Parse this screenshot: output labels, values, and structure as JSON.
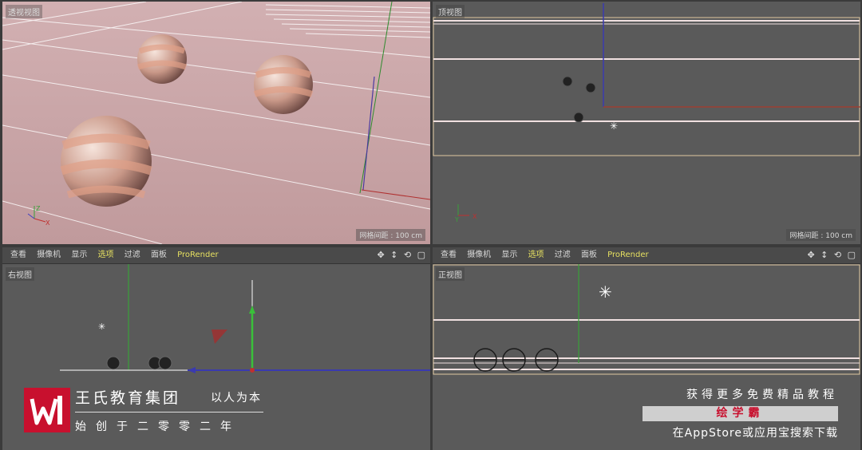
{
  "viewports": {
    "perspective": {
      "label": "透视视图",
      "grid_label": "网格间距 : 100 cm"
    },
    "top": {
      "label": "顶视图",
      "grid_label": "网格间距 : 100 cm"
    },
    "right": {
      "label": "右视图"
    },
    "front": {
      "label": "正视图"
    }
  },
  "menu": {
    "items": [
      "查看",
      "摄像机",
      "显示",
      "选项",
      "过滤",
      "面板",
      "ProRender"
    ],
    "nav_icons": "✥ ↕ ⟲ ▢"
  },
  "brand": {
    "logo_letter": "W",
    "title": "王氏教育集团",
    "motto": "以人为本",
    "subtitle": "始创于二零零二年"
  },
  "promo": {
    "line1": "获得更多免费精品教程",
    "highlight": "绘学霸",
    "line3": "在AppStore或应用宝搜索下载"
  },
  "colors": {
    "accent_yellow": "#e6e060",
    "brand_red": "#c8102e",
    "sphere_peach": "#e0a088"
  }
}
